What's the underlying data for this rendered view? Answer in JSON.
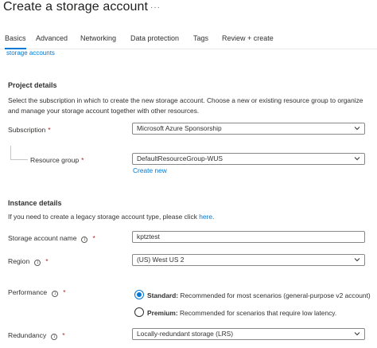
{
  "header": {
    "title": "Create a storage account",
    "more_label": "···"
  },
  "tabs": [
    {
      "label": "Basics"
    },
    {
      "label": "Advanced"
    },
    {
      "label": "Networking"
    },
    {
      "label": "Data protection"
    },
    {
      "label": "Tags"
    },
    {
      "label": "Review + create"
    }
  ],
  "cut_link": "storage accounts",
  "project": {
    "heading": "Project details",
    "description": "Select the subscription in which to create the new storage account. Choose a new or existing resource group to organize and manage your storage account together with other resources.",
    "subscription_label": "Subscription",
    "subscription_value": "Microsoft Azure Sponsorship",
    "resource_group_label": "Resource group",
    "resource_group_value": "DefaultResourceGroup-WUS",
    "create_new": "Create new"
  },
  "instance": {
    "heading": "Instance details",
    "description_prefix": "If you need to create a legacy storage account type, please click ",
    "description_link": "here",
    "description_suffix": ".",
    "name_label": "Storage account name",
    "name_value": "kptztest",
    "region_label": "Region",
    "region_value": "(US) West US 2",
    "performance_label": "Performance",
    "standard_title": "Standard:",
    "standard_desc": " Recommended for most scenarios (general-purpose v2 account)",
    "premium_title": "Premium:",
    "premium_desc": " Recommended for scenarios that require low latency.",
    "redundancy_label": "Redundancy",
    "redundancy_value": "Locally-redundant storage (LRS)"
  },
  "required_mark": "*",
  "info_glyph": "i",
  "colors": {
    "accent": "#0078d4",
    "required": "#a4262c",
    "border": "#8a8886"
  }
}
